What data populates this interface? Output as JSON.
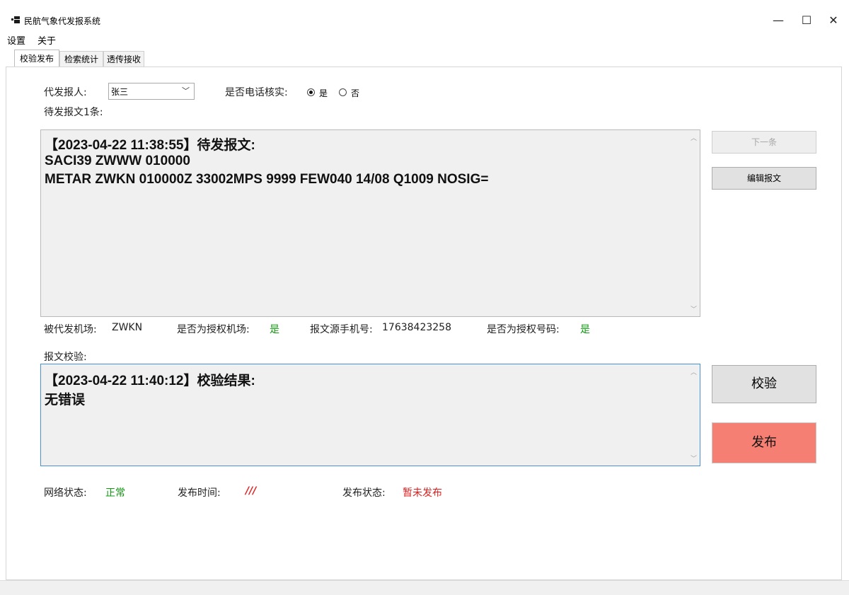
{
  "window": {
    "title": "民航气象代发报系统",
    "minimize": "—",
    "maximize": "☐",
    "close": "✕"
  },
  "menu": [
    "设置",
    "关于"
  ],
  "tabs": [
    {
      "label": "校验发布",
      "active": true
    },
    {
      "label": "检索统计",
      "active": false
    },
    {
      "label": "透传接收",
      "active": false
    }
  ],
  "sender": {
    "label": "代发报人:",
    "value": "张三"
  },
  "phone_verify": {
    "label": "是否电话核实:",
    "options": [
      "是",
      "否"
    ],
    "selected": "是"
  },
  "pending": {
    "label": "待发报文1条:",
    "lines": [
      "【2023-04-22 11:38:55】待发报文:",
      "SACI39 ZWWW 010000",
      "METAR ZWKN 010000Z 33002MPS 9999 FEW040 14/08 Q1009 NOSIG="
    ]
  },
  "buttons": {
    "next": "下一条",
    "edit": "编辑报文",
    "verify": "校验",
    "publish": "发布"
  },
  "info": {
    "airport_label": "被代发机场:",
    "airport_value": "ZWKN",
    "auth_airport_label": "是否为授权机场:",
    "auth_airport_value": "是",
    "phone_label": "报文源手机号:",
    "phone_value": "17638423258",
    "auth_phone_label": "是否为授权号码:",
    "auth_phone_value": "是"
  },
  "check": {
    "label": "报文校验:",
    "lines": [
      "【2023-04-22 11:40:12】校验结果:",
      "无错误"
    ]
  },
  "status": {
    "network_label": "网络状态:",
    "network_value": "正常",
    "time_label": "发布时间:",
    "time_value": "///",
    "publish_label": "发布状态:",
    "publish_value": "暂未发布"
  },
  "colors": {
    "ok": "#119911",
    "alert": "#e02020",
    "publish_button": "#f47f72"
  }
}
